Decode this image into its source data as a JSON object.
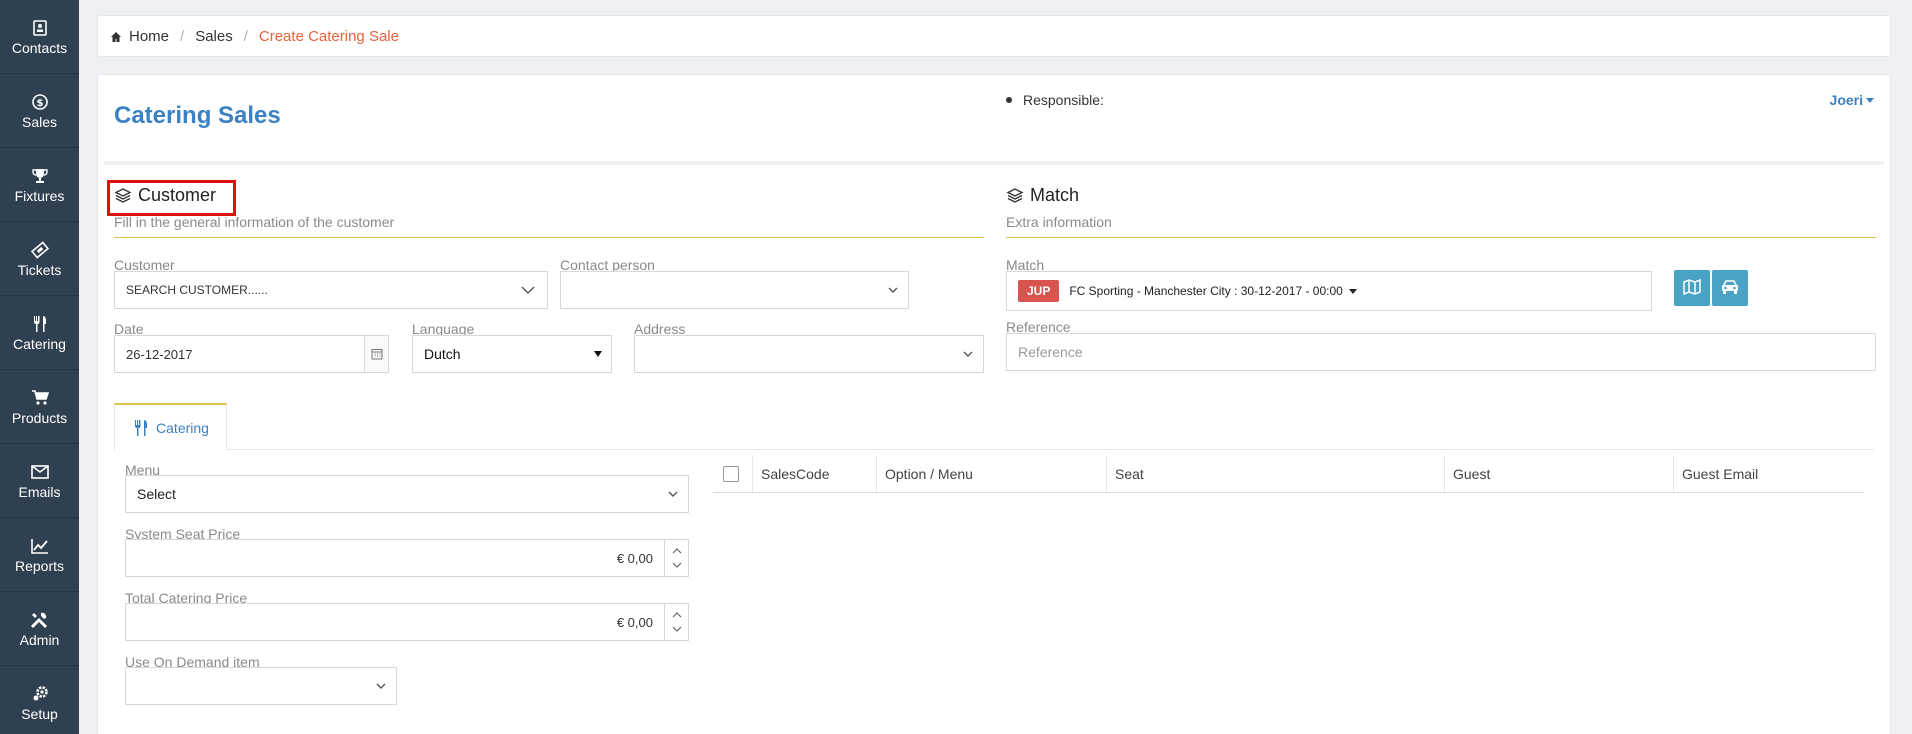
{
  "sidebar": {
    "items": [
      {
        "label": "Contacts",
        "icon": "contact-card-icon"
      },
      {
        "label": "Sales",
        "icon": "dollar-icon"
      },
      {
        "label": "Fixtures",
        "icon": "trophy-icon"
      },
      {
        "label": "Tickets",
        "icon": "ticket-icon"
      },
      {
        "label": "Catering",
        "icon": "fork-knife-icon"
      },
      {
        "label": "Products",
        "icon": "cart-icon"
      },
      {
        "label": "Emails",
        "icon": "envelope-icon"
      },
      {
        "label": "Reports",
        "icon": "line-chart-icon"
      },
      {
        "label": "Admin",
        "icon": "tools-icon"
      },
      {
        "label": "Setup",
        "icon": "gear-icon"
      }
    ]
  },
  "breadcrumb": {
    "home": "Home",
    "sales": "Sales",
    "current": "Create Catering Sale"
  },
  "header": {
    "title": "Catering Sales",
    "responsible_label": "Responsible:",
    "user": "Joeri"
  },
  "customer_section": {
    "title": "Customer",
    "subtitle": "Fill in the general information of the customer",
    "customer_label": "Customer",
    "customer_value": "SEARCH CUSTOMER......",
    "contact_label": "Contact person",
    "contact_value": "",
    "date_label": "Date",
    "date_value": "26-12-2017",
    "language_label": "Language",
    "language_value": "Dutch",
    "address_label": "Address",
    "address_value": ""
  },
  "match_section": {
    "title": "Match",
    "subtitle": "Extra information",
    "match_label": "Match",
    "match_badge": "JUP",
    "match_value": "FC Sporting - Manchester City : 30-12-2017 - 00:00",
    "reference_label": "Reference",
    "reference_placeholder": "Reference"
  },
  "tabs": [
    {
      "label": "Catering"
    }
  ],
  "catering": {
    "menu_label": "Menu",
    "menu_value": "Select",
    "seat_price_label": "System Seat Price",
    "seat_price_value": "€ 0,00",
    "total_price_label": "Total Catering Price",
    "total_price_value": "€ 0,00",
    "on_demand_label": "Use On Demand item",
    "on_demand_value": ""
  },
  "table": {
    "columns": [
      "SalesCode",
      "Option / Menu",
      "Seat",
      "Guest",
      "Guest Email"
    ]
  },
  "colors": {
    "sidebar_bg": "#2f4050",
    "accent_blue": "#3b82c4",
    "breadcrumb_active": "#e8623a",
    "section_line": "#e0c34a",
    "badge_red": "#d9534f",
    "icon_button": "#4aa3c4",
    "highlight_red": "#e01010"
  }
}
